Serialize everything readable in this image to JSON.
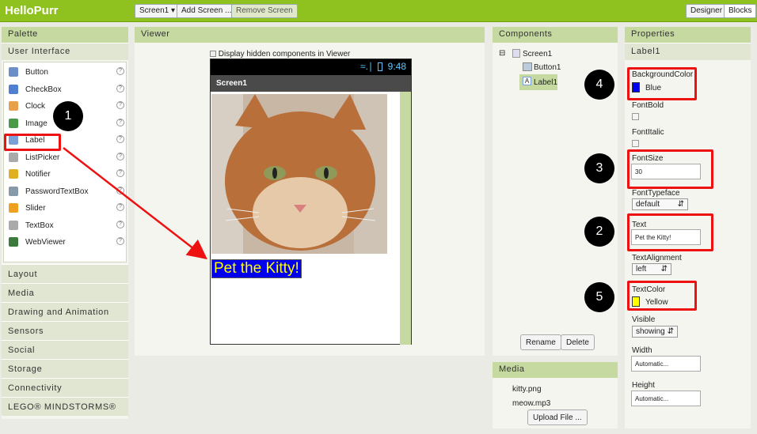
{
  "app": {
    "title": "HelloPurr"
  },
  "toolbar": {
    "screen_select": "Screen1 ▾",
    "add_screen": "Add Screen ...",
    "remove_screen": "Remove Screen",
    "designer": "Designer",
    "blocks": "Blocks"
  },
  "palette": {
    "title": "Palette",
    "user_interface": "User Interface",
    "items": [
      {
        "label": "Button",
        "icon": "button-icon",
        "color": "#6b8fc7"
      },
      {
        "label": "CheckBox",
        "icon": "checkbox-icon",
        "color": "#4f7fd0"
      },
      {
        "label": "Clock",
        "icon": "clock-icon",
        "color": "#e8a04a"
      },
      {
        "label": "Image",
        "icon": "image-icon",
        "color": "#4a9a4a"
      },
      {
        "label": "Label",
        "icon": "label-icon",
        "color": "#7aa0d8"
      },
      {
        "label": "ListPicker",
        "icon": "listpicker-icon",
        "color": "#aaaaaa"
      },
      {
        "label": "Notifier",
        "icon": "notifier-icon",
        "color": "#e0b020"
      },
      {
        "label": "PasswordTextBox",
        "icon": "password-icon",
        "color": "#8899aa"
      },
      {
        "label": "Slider",
        "icon": "slider-icon",
        "color": "#f0a020"
      },
      {
        "label": "TextBox",
        "icon": "textbox-icon",
        "color": "#aaaaaa"
      },
      {
        "label": "WebViewer",
        "icon": "webviewer-icon",
        "color": "#3a7a3a"
      }
    ],
    "help": "?",
    "sections": [
      "Layout",
      "Media",
      "Drawing and Animation",
      "Sensors",
      "Social",
      "Storage",
      "Connectivity",
      "LEGO® MINDSTORMS®"
    ]
  },
  "viewer": {
    "title": "Viewer",
    "hidden_checkbox": "Display hidden components in Viewer",
    "status_time": "9:48",
    "screen_title": "Screen1",
    "label_text": "Pet the Kitty!"
  },
  "components": {
    "title": "Components",
    "tree": {
      "root": "Screen1",
      "children": [
        "Button1",
        "Label1"
      ]
    },
    "collapse": "⊟",
    "rename": "Rename",
    "delete": "Delete"
  },
  "media": {
    "title": "Media",
    "files": [
      "kitty.png",
      "meow.mp3"
    ],
    "upload": "Upload File ..."
  },
  "properties": {
    "title": "Properties",
    "component": "Label1",
    "background_color_label": "BackgroundColor",
    "background_color_value": "Blue",
    "font_bold_label": "FontBold",
    "font_italic_label": "FontItalic",
    "font_size_label": "FontSize",
    "font_size_value": "30",
    "font_typeface_label": "FontTypeface",
    "font_typeface_value": "default",
    "text_label": "Text",
    "text_value": "Pet the Kitty!",
    "text_alignment_label": "TextAlignment",
    "text_alignment_value": "left",
    "text_color_label": "TextColor",
    "text_color_value": "Yellow",
    "visible_label": "Visible",
    "visible_value": "showing",
    "width_label": "Width",
    "width_value": "Automatic...",
    "height_label": "Height",
    "height_value": "Automatic..."
  },
  "annotations": {
    "b1": "1",
    "b2": "2",
    "b3": "3",
    "b4": "4",
    "b5": "5"
  },
  "colors": {
    "accent": "#8fc21f",
    "highlight": "#e11111",
    "blue": "#0000ee",
    "yellow": "#ffff00"
  }
}
